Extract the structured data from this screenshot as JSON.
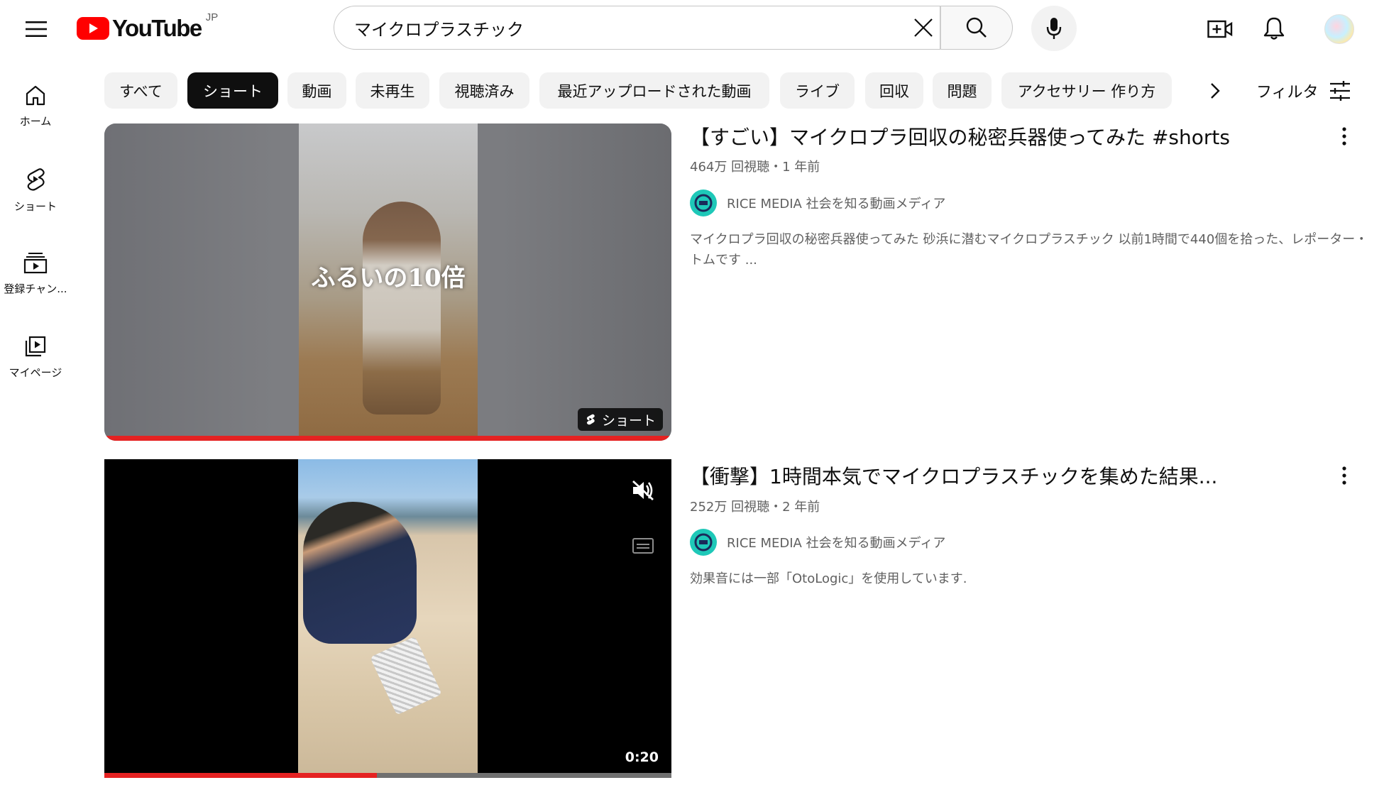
{
  "header": {
    "logo_text": "YouTube",
    "country_code": "JP",
    "search_value": "マイクロプラスチック",
    "icons": [
      "menu-icon",
      "close-icon",
      "search-icon",
      "microphone-icon",
      "create-video-icon",
      "bell-icon"
    ]
  },
  "sidebar": {
    "items": [
      {
        "label": "ホーム",
        "icon": "home-icon"
      },
      {
        "label": "ショート",
        "icon": "shorts-icon"
      },
      {
        "label": "登録チャン...",
        "icon": "subscriptions-icon"
      },
      {
        "label": "マイページ",
        "icon": "library-icon"
      }
    ]
  },
  "chips": {
    "items": [
      "すべて",
      "ショート",
      "動画",
      "未再生",
      "視聴済み",
      "最近アップロードされた動画",
      "ライブ",
      "回収",
      "問題",
      "アクセサリー 作り方"
    ],
    "selected": "ショート",
    "filter_label": "フィルタ"
  },
  "results": [
    {
      "title": "【すごい】マイクロプラ回収の秘密兵器使ってみた #shorts",
      "meta": "464万 回視聴・1 年前",
      "channel": "RICE MEDIA 社会を知る動画メディア",
      "description": "マイクロプラ回収の秘密兵器使ってみた 砂浜に潜むマイクロプラスチック 以前1時間で440個を拾った、レポーター・トムです ...",
      "overlay_text": "ふるいの10倍",
      "badge": "ショート",
      "watched_fraction": 1.0
    },
    {
      "title": "【衝撃】1時間本気でマイクロプラスチックを集めた結果...",
      "meta": "252万 回視聴・2 年前",
      "channel": "RICE MEDIA 社会を知る動画メディア",
      "description": "効果音には一部「OtoLogic」を使用しています.",
      "duration": "0:20",
      "playback_fraction": 0.48
    }
  ],
  "colors": {
    "brand_red": "#ff0000",
    "progress_red": "#e52222",
    "chip_active": "#0f0f0f",
    "chip_bg": "#f2f2f2",
    "secondary_text": "#606060",
    "channel_avatar": "#1ec8b8"
  }
}
